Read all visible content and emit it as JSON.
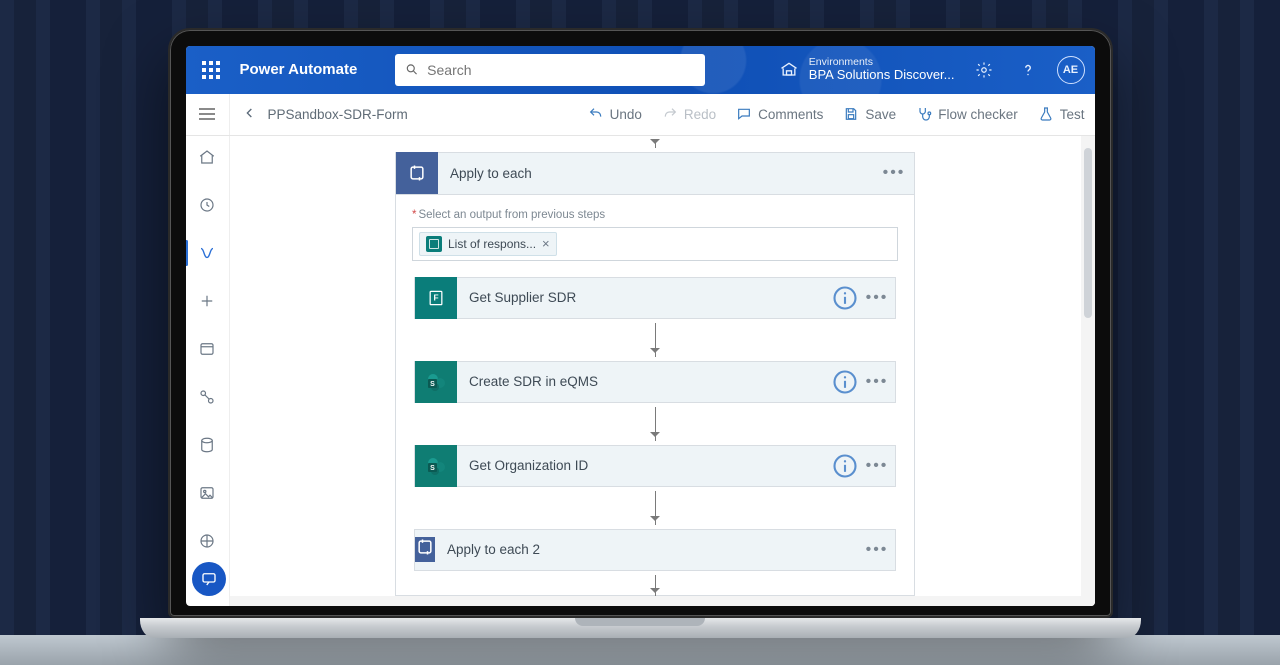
{
  "header": {
    "app_title": "Power Automate",
    "search_placeholder": "Search",
    "env_label": "Environments",
    "env_value": "BPA Solutions Discover...",
    "avatar_initials": "AE"
  },
  "commandbar": {
    "flow_title": "PPSandbox-SDR-Form",
    "undo": "Undo",
    "redo": "Redo",
    "comments": "Comments",
    "save": "Save",
    "flow_checker": "Flow checker",
    "test": "Test"
  },
  "chatbot": {
    "label": "Ask a chatbot"
  },
  "flow": {
    "ate_title": "Apply to each",
    "ate_field_label": "Select an output from previous steps",
    "ate_token": "List of respons...",
    "actions": [
      {
        "title": "Get Supplier SDR",
        "icon": "forms"
      },
      {
        "title": "Create SDR in eQMS",
        "icon": "sharepoint"
      },
      {
        "title": "Get Organization ID",
        "icon": "sharepoint"
      }
    ],
    "ate2_title": "Apply to each 2"
  }
}
